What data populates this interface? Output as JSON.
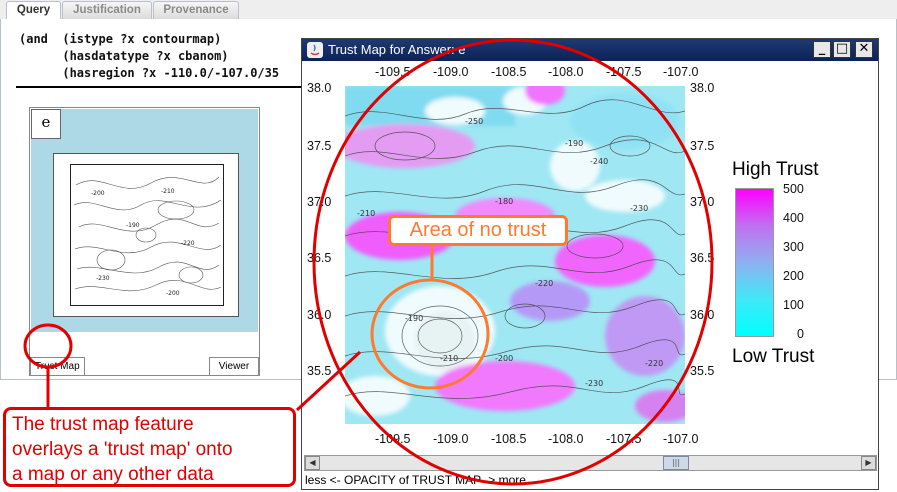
{
  "tabs": [
    {
      "label": "Query",
      "active": true
    },
    {
      "label": "Justification",
      "active": false
    },
    {
      "label": "Provenance",
      "active": false
    }
  ],
  "query": {
    "lines": [
      "(and  (istype ?x contourmap)",
      "      (hasdatatype ?x cbanom)",
      "      (hasregion ?x -110.0/-107.0/35"
    ]
  },
  "result": {
    "label": "e",
    "trust_map_button": "Trust Map",
    "viewer_button": "Viewer"
  },
  "trust_window": {
    "title": "Trust Map for Answer: e",
    "minimize": "_",
    "maximize": "□",
    "close": "✕",
    "opacity_label": "less <- OPACITY of TRUST MAP -> more",
    "scroll_left": "◀",
    "scroll_right": "▶",
    "scroll_thumb": "|||",
    "x_ticks": [
      "-109.5",
      "-109.0",
      "-108.5",
      "-108.0",
      "-107.5",
      "-107.0"
    ],
    "y_ticks": [
      "38.0",
      "37.5",
      "37.0",
      "36.5",
      "36.0",
      "35.5"
    ],
    "legend": {
      "high_label": "High Trust",
      "low_label": "Low Trust",
      "ticks": [
        "500",
        "400",
        "300",
        "200",
        "100",
        "0"
      ],
      "high_color": "#ff00ff",
      "low_color": "#00ffff"
    },
    "contour_labels": [
      "-190",
      "-200",
      "-210",
      "-220",
      "-230",
      "-240",
      "-250",
      "-180"
    ]
  },
  "annotations": {
    "no_trust": "Area of no trust",
    "feature_note": [
      "The trust map feature",
      "overlays a 'trust map' onto",
      "a map or any other data"
    ],
    "colors": {
      "red": "#e00000",
      "orange": "#ff7a2e"
    }
  }
}
